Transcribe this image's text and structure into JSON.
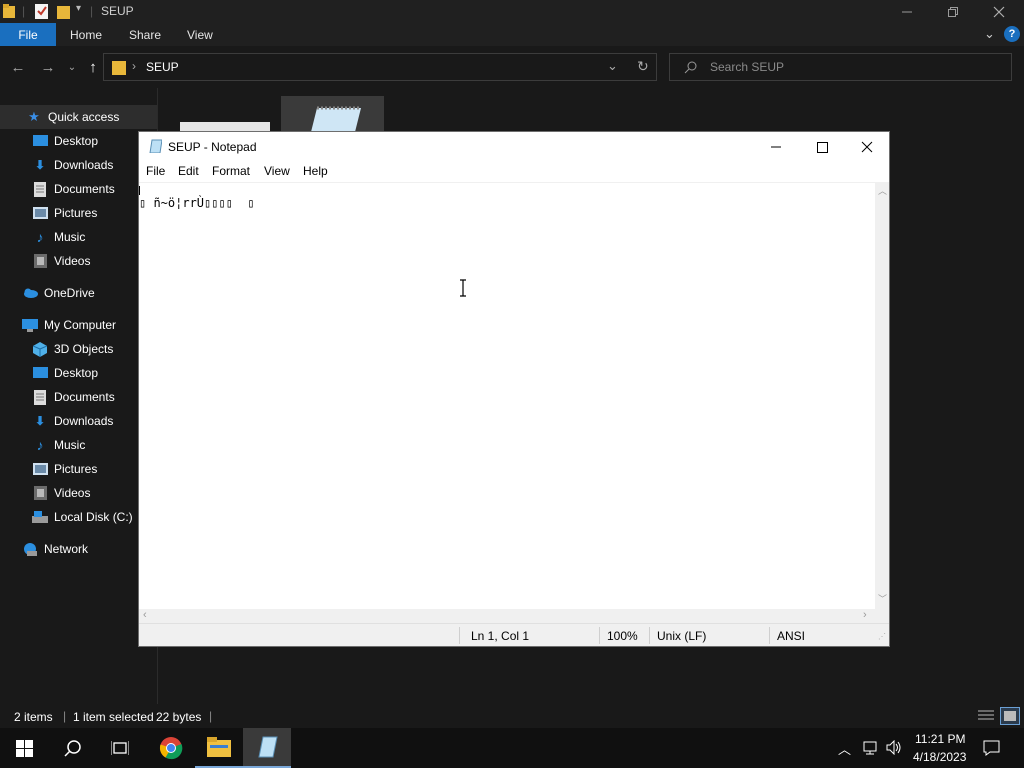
{
  "explorer": {
    "title": "SEUP",
    "ribbon_tabs": [
      "File",
      "Home",
      "Share",
      "View"
    ],
    "breadcrumb": "SEUP",
    "search_placeholder": "Search SEUP",
    "nav": {
      "quick_access": "Quick access",
      "qa_items": [
        "Desktop",
        "Downloads",
        "Documents",
        "Pictures",
        "Music",
        "Videos"
      ],
      "onedrive": "OneDrive",
      "my_computer": "My Computer",
      "pc_items": [
        "3D Objects",
        "Desktop",
        "Documents",
        "Downloads",
        "Music",
        "Pictures",
        "Videos",
        "Local Disk (C:)"
      ],
      "network": "Network"
    },
    "status": {
      "items": "2 items",
      "selected": "1 item selected",
      "size": "22 bytes"
    }
  },
  "notepad": {
    "title": "SEUP - Notepad",
    "menu": [
      "File",
      "Edit",
      "Format",
      "View",
      "Help"
    ],
    "text": "▯ ñ~ö¦rrÙ▯▯▯▯  ▯",
    "status": {
      "position": "Ln 1, Col 1",
      "zoom": "100%",
      "eol": "Unix (LF)",
      "encoding": "ANSI"
    }
  },
  "taskbar": {
    "time": "11:21 PM",
    "date": "4/18/2023"
  },
  "colors": {
    "accent": "#1a6fbf",
    "dark_bg": "#191919",
    "folder": "#e8b73a"
  }
}
